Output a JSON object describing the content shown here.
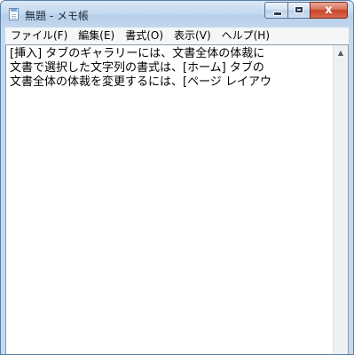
{
  "window": {
    "title": "無題 - メモ帳",
    "icon": "notepad-icon",
    "caption_buttons": {
      "minimize_icon": "minimize-icon",
      "maximize_icon": "maximize-icon",
      "close_glyph": "x"
    },
    "colors": {
      "close_button": "#c7452a",
      "frame": "#c4d8ee"
    }
  },
  "menu": {
    "items": [
      {
        "label": "ファイル(F)"
      },
      {
        "label": "編集(E)"
      },
      {
        "label": "書式(O)"
      },
      {
        "label": "表示(V)"
      },
      {
        "label": "ヘルプ(H)"
      }
    ]
  },
  "editor": {
    "lines": [
      "[挿入] タブのギャラリーには、文書全体の体裁に",
      "文書で選択した文字列の書式は、[ホーム] タブの",
      "文書全体の体裁を変更するには、[ページ レイアウ"
    ]
  },
  "scrollbar": {
    "up_arrow_icon": "scroll-up-arrow-icon"
  }
}
